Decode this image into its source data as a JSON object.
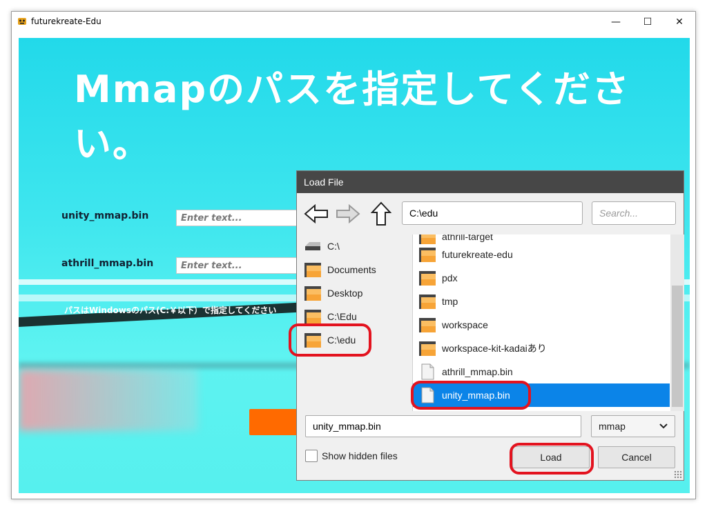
{
  "window": {
    "title": "futurekreate-Edu",
    "minimize_glyph": "—",
    "maximize_glyph": "☐",
    "close_glyph": "✕"
  },
  "app": {
    "headline": "Mmapのパスを指定してください。",
    "fields": [
      {
        "label": "unity_mmap.bin",
        "placeholder": "Enter text..."
      },
      {
        "label": "athrill_mmap.bin",
        "placeholder": "Enter text..."
      }
    ],
    "note": "パスはWindowsのパス(C:￥以下）で指定してください"
  },
  "dialog": {
    "title": "Load File",
    "path": "C:\\edu",
    "search_placeholder": "Search...",
    "left_items": [
      {
        "label": "C:\\",
        "icon": "drive-icon"
      },
      {
        "label": "Documents",
        "icon": "folder-icon"
      },
      {
        "label": "Desktop",
        "icon": "folder-icon"
      },
      {
        "label": "C:\\Edu",
        "icon": "folder-icon"
      },
      {
        "label": "C:\\edu",
        "icon": "folder-icon"
      }
    ],
    "files": [
      {
        "label": "athrill-target",
        "type": "folder"
      },
      {
        "label": "futurekreate-edu",
        "type": "folder"
      },
      {
        "label": "pdx",
        "type": "folder"
      },
      {
        "label": "tmp",
        "type": "folder"
      },
      {
        "label": "workspace",
        "type": "folder"
      },
      {
        "label": "workspace-kit-kadaiあり",
        "type": "folder"
      },
      {
        "label": "athrill_mmap.bin",
        "type": "file"
      },
      {
        "label": "unity_mmap.bin",
        "type": "file",
        "selected": true
      }
    ],
    "filename": "unity_mmap.bin",
    "filter": "mmap",
    "show_hidden_label": "Show hidden files",
    "load_label": "Load",
    "cancel_label": "Cancel"
  },
  "colors": {
    "highlight": "#e3131f",
    "selection": "#0b84e8",
    "dialog_title_bg": "#474747",
    "scene": "#3fe6ee"
  }
}
